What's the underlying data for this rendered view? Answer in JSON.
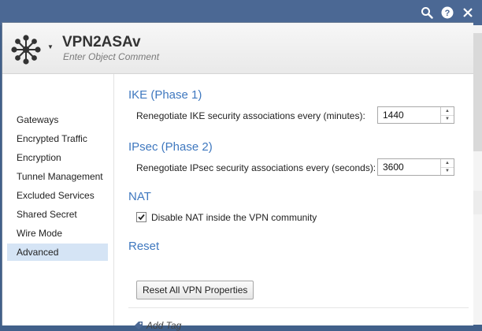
{
  "toolbar": {
    "icons": [
      "search-icon",
      "help-icon",
      "close-icon"
    ]
  },
  "header": {
    "object_name": "VPN2ASAv",
    "comment_placeholder": "Enter Object Comment"
  },
  "sidebar": {
    "items": [
      {
        "label": "Gateways",
        "active": false
      },
      {
        "label": "Encrypted Traffic",
        "active": false
      },
      {
        "label": "Encryption",
        "active": false
      },
      {
        "label": "Tunnel Management",
        "active": false
      },
      {
        "label": "Excluded Services",
        "active": false
      },
      {
        "label": "Shared Secret",
        "active": false
      },
      {
        "label": "Wire Mode",
        "active": false
      },
      {
        "label": "Advanced",
        "active": true
      }
    ]
  },
  "main": {
    "ike": {
      "title": "IKE (Phase 1)",
      "label": "Renegotiate IKE security associations every (minutes):",
      "value": "1440"
    },
    "ipsec": {
      "title": "IPsec (Phase 2)",
      "label": "Renegotiate IPsec security associations every (seconds):",
      "value": "3600"
    },
    "nat": {
      "title": "NAT",
      "checkbox_label": "Disable NAT inside the VPN community",
      "checked": true
    },
    "reset": {
      "title": "Reset",
      "button_label": "Reset All VPN Properties"
    },
    "tag": {
      "label": "Add Tag"
    }
  },
  "colors": {
    "accent": "#3f78bf",
    "active_nav": "#d5e4f5",
    "frame": "#4b6894"
  }
}
